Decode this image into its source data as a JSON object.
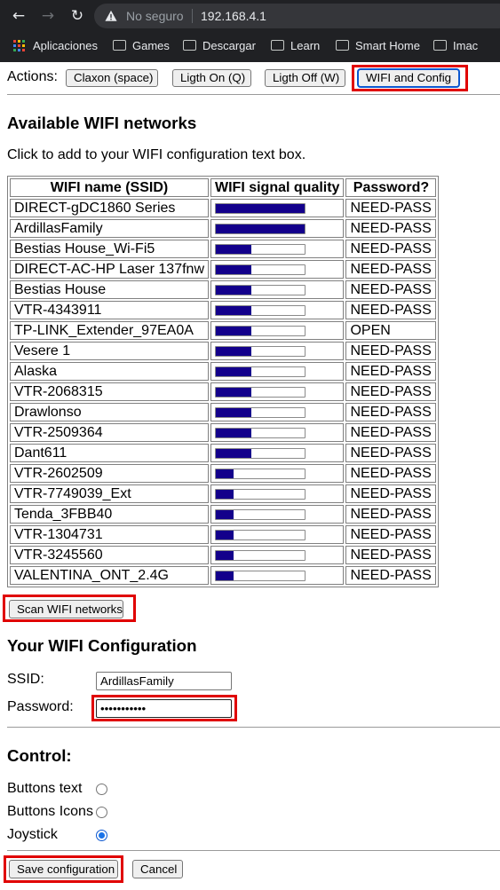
{
  "browser": {
    "security_text": "No seguro",
    "url": "192.168.4.1",
    "bookmarks": [
      {
        "label": "Aplicaciones",
        "icon": "apps-grid-icon"
      },
      {
        "label": "Games",
        "icon": "folder-icon"
      },
      {
        "label": "Descargar",
        "icon": "folder-icon"
      },
      {
        "label": "Learn",
        "icon": "folder-icon"
      },
      {
        "label": "Smart Home",
        "icon": "folder-icon"
      },
      {
        "label": "Imac",
        "icon": "folder-icon"
      }
    ]
  },
  "actions": {
    "label": "Actions:",
    "buttons": [
      {
        "label": "Claxon (space)"
      },
      {
        "label": "Ligth On (Q)"
      },
      {
        "label": "Ligth Off (W)"
      },
      {
        "label": "WIFI and Config"
      }
    ]
  },
  "networks": {
    "title": "Available WIFI networks",
    "subtitle": "Click to add to your WIFI configuration text box.",
    "headers": {
      "ssid": "WIFI name (SSID)",
      "signal": "WIFI signal quality",
      "password": "Password?"
    },
    "rows": [
      {
        "ssid": "DIRECT-gDC1860 Series",
        "signal": 1.0,
        "password": "NEED-PASS"
      },
      {
        "ssid": "ArdillasFamily",
        "signal": 1.0,
        "password": "NEED-PASS"
      },
      {
        "ssid": "Bestias House_Wi-Fi5",
        "signal": 0.4,
        "password": "NEED-PASS"
      },
      {
        "ssid": "DIRECT-AC-HP Laser 137fnw",
        "signal": 0.4,
        "password": "NEED-PASS"
      },
      {
        "ssid": "Bestias House",
        "signal": 0.4,
        "password": "NEED-PASS"
      },
      {
        "ssid": "VTR-4343911",
        "signal": 0.4,
        "password": "NEED-PASS"
      },
      {
        "ssid": "TP-LINK_Extender_97EA0A",
        "signal": 0.4,
        "password": "OPEN"
      },
      {
        "ssid": "Vesere 1",
        "signal": 0.4,
        "password": "NEED-PASS"
      },
      {
        "ssid": "Alaska",
        "signal": 0.4,
        "password": "NEED-PASS"
      },
      {
        "ssid": "VTR-2068315",
        "signal": 0.4,
        "password": "NEED-PASS"
      },
      {
        "ssid": "Drawlonso",
        "signal": 0.4,
        "password": "NEED-PASS"
      },
      {
        "ssid": "VTR-2509364",
        "signal": 0.4,
        "password": "NEED-PASS"
      },
      {
        "ssid": "Dant611",
        "signal": 0.4,
        "password": "NEED-PASS"
      },
      {
        "ssid": "VTR-2602509",
        "signal": 0.2,
        "password": "NEED-PASS"
      },
      {
        "ssid": "VTR-7749039_Ext",
        "signal": 0.2,
        "password": "NEED-PASS"
      },
      {
        "ssid": "Tenda_3FBB40",
        "signal": 0.2,
        "password": "NEED-PASS"
      },
      {
        "ssid": "VTR-1304731",
        "signal": 0.2,
        "password": "NEED-PASS"
      },
      {
        "ssid": "VTR-3245560",
        "signal": 0.2,
        "password": "NEED-PASS"
      },
      {
        "ssid": "VALENTINA_ONT_2.4G",
        "signal": 0.2,
        "password": "NEED-PASS"
      }
    ],
    "scan_label": "Scan WIFI networks"
  },
  "config": {
    "title": "Your WIFI Configuration",
    "ssid_label": "SSID:",
    "ssid_value": "ArdillasFamily",
    "password_label": "Password:",
    "password_value": "•••••••••••"
  },
  "control": {
    "title": "Control:",
    "options": [
      {
        "label": "Buttons text",
        "checked": false
      },
      {
        "label": "Buttons Icons",
        "checked": false
      },
      {
        "label": "Joystick",
        "checked": true
      }
    ],
    "save_label": "Save configuration",
    "cancel_label": "Cancel"
  },
  "colors": {
    "signal_bar": "#13008b",
    "highlight": "#e00000",
    "chrome_bg": "#202124"
  }
}
